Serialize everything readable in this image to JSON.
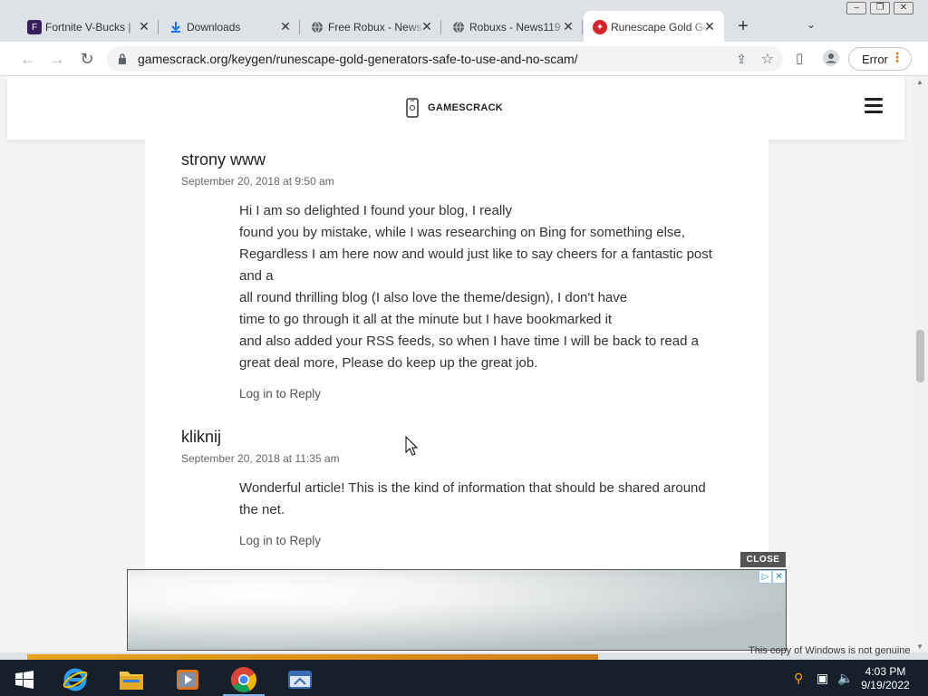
{
  "browser": {
    "tabs": [
      {
        "title": "Fortnite V-Bucks | ",
        "favicon": "fortnite-icon"
      },
      {
        "title": "Downloads",
        "favicon": "download-icon"
      },
      {
        "title": "Free Robux - News",
        "favicon": "globe-icon"
      },
      {
        "title": "Robuxs - News119",
        "favicon": "globe-icon"
      },
      {
        "title": "Runescape Gold Generators",
        "favicon": "runescape-icon",
        "active": true
      }
    ],
    "new_tab": "+",
    "url": "gamescrack.org/keygen/runescape-gold-generators-safe-to-use-and-no-scam/",
    "error_label": "Error"
  },
  "site": {
    "name": "GAMESCRACK"
  },
  "comments": [
    {
      "author": "strony www",
      "date": "September 20, 2018 at 9:50 am",
      "lines": [
        "Hi I am so delighted I found your blog, I really",
        "found you by mistake, while I was researching on Bing for something else,",
        "Regardless I am here now and would just like to say cheers for a fantastic post",
        "and a",
        "all round thrilling blog (I also love the theme/design), I don't have",
        "time to go through it all at the minute but I have bookmarked it",
        "and also added your RSS feeds, so when I have time I will be back to read a",
        "great deal more, Please do keep up the great job."
      ],
      "reply": "Log in to Reply"
    },
    {
      "author": "kliknij",
      "date": "September 20, 2018 at 11:35 am",
      "lines": [
        "Wonderful article! This is the kind of information that should be shared around",
        "the net."
      ],
      "reply": "Log in to Reply"
    }
  ],
  "ad": {
    "close_label": "CLOSE",
    "badge_info": "▷",
    "badge_close": "✕"
  },
  "watermark": "This copy of Windows is not genuine",
  "taskbar": {
    "time": "4:03 PM",
    "date": "9/19/2022"
  },
  "colors": {
    "accent_tab": "#ffffff",
    "taskbar": "#16202a",
    "runescape_red": "#d6242b"
  }
}
